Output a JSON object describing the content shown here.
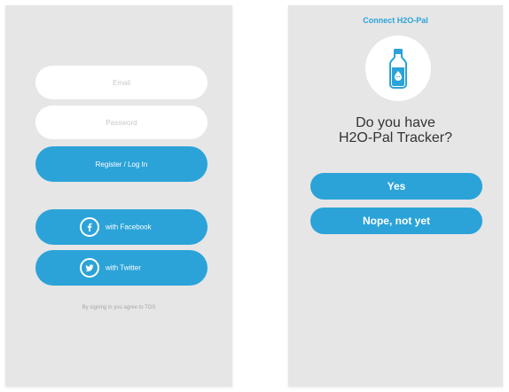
{
  "login": {
    "email_placeholder": "Email",
    "password_placeholder": "Password",
    "register_label": "Register / Log In",
    "facebook_label": "with Facebook",
    "twitter_label": "with Twitter",
    "tos_text": "By signing in you agree to TOS",
    "facebook_icon": "facebook-icon",
    "twitter_icon": "twitter-icon"
  },
  "connect": {
    "title": "Connect H2O-Pal",
    "question_line1": "Do you have",
    "question_line2": "H2O-Pal Tracker?",
    "yes_label": "Yes",
    "nope_label": "Nope, not yet",
    "bottle_icon": "water-bottle-icon"
  },
  "colors": {
    "accent": "#2ba3d8",
    "screen_bg": "#e6e6e6",
    "field_bg": "#ffffff",
    "question_text": "#333333"
  }
}
